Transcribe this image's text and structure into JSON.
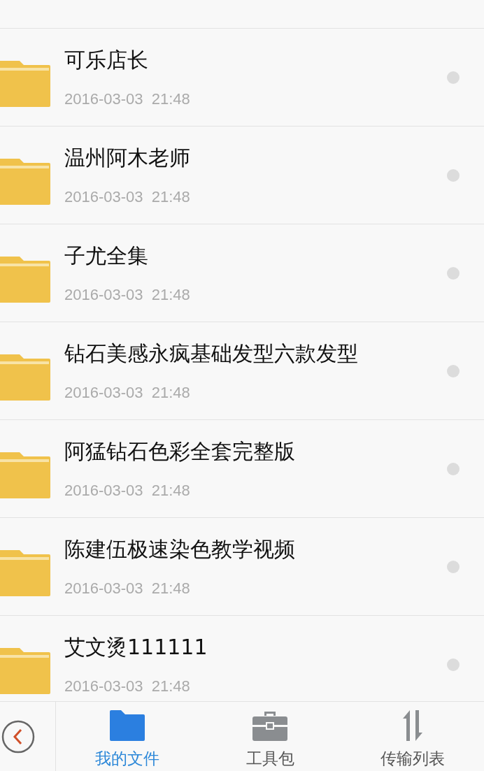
{
  "files": [
    {
      "kind": "folder",
      "name": "可乐店长",
      "date": "2016-03-03  21:48",
      "checked": false
    },
    {
      "kind": "folder",
      "name": "温州阿木老师",
      "date": "2016-03-03  21:48",
      "checked": false
    },
    {
      "kind": "folder",
      "name": "子尤全集",
      "date": "2016-03-03  21:48",
      "checked": false
    },
    {
      "kind": "folder",
      "name": "钻石美感永疯基础发型六款发型",
      "date": "2016-03-03  21:48",
      "checked": false
    },
    {
      "kind": "folder",
      "name": "阿猛钻石色彩全套完整版",
      "date": "2016-03-03  21:48",
      "checked": false
    },
    {
      "kind": "folder",
      "name": "陈建伍极速染色教学视频",
      "date": "2016-03-03  21:48",
      "checked": false
    },
    {
      "kind": "folder",
      "name": "艾文烫111111",
      "date": "2016-03-03  21:48",
      "checked": false
    }
  ],
  "tabs": [
    {
      "kind": "files",
      "label": "我的文件",
      "selected": true
    },
    {
      "kind": "tools",
      "label": "工具包",
      "selected": false
    },
    {
      "kind": "transfer",
      "label": "传输列表",
      "selected": false
    }
  ]
}
